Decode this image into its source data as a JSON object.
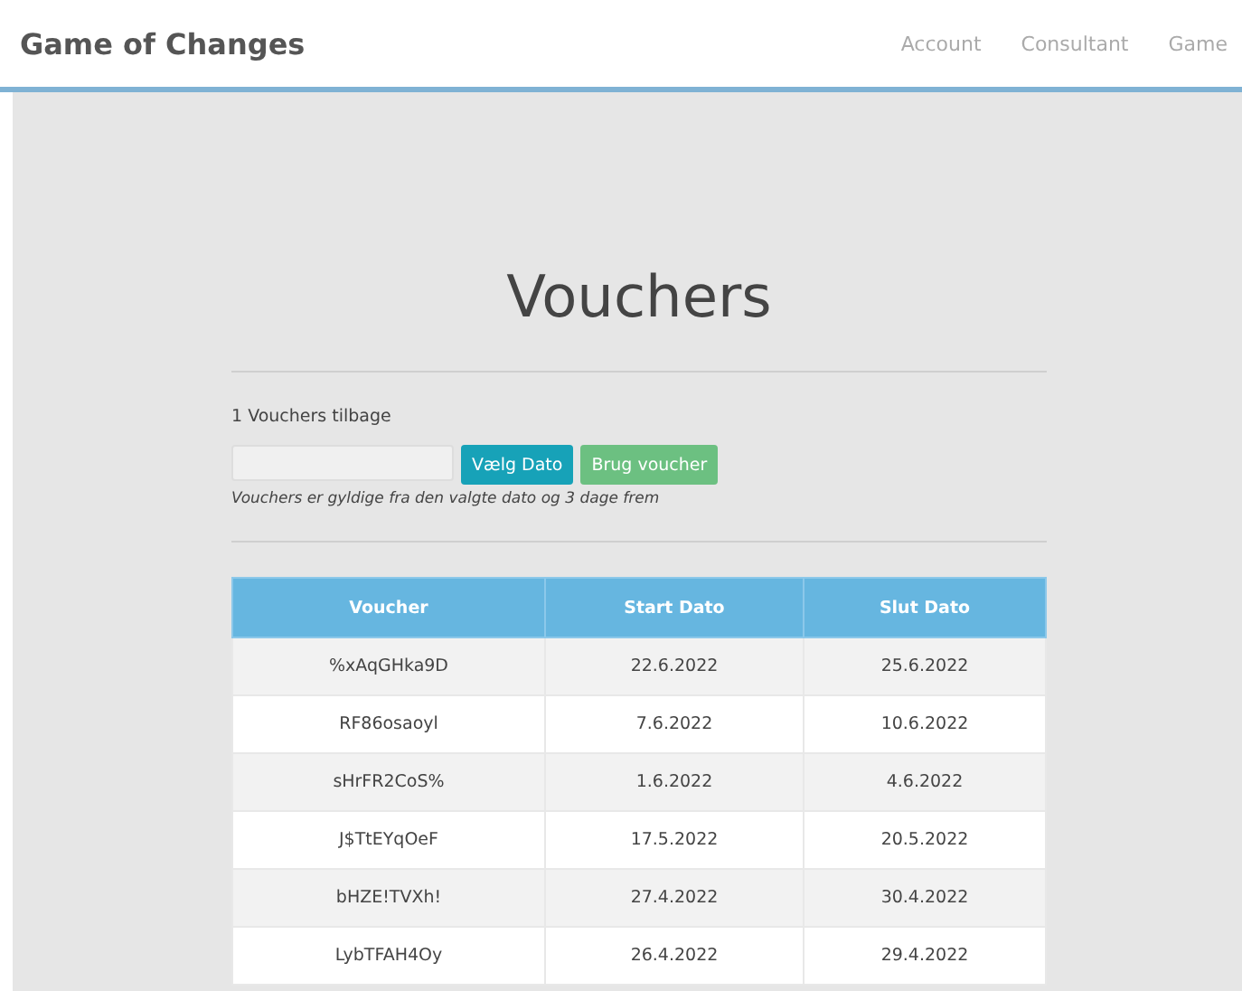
{
  "header": {
    "brand": "Game of Changes",
    "nav": [
      {
        "label": "Account"
      },
      {
        "label": "Consultant"
      },
      {
        "label": "Game"
      }
    ]
  },
  "title": "Vouchers",
  "remaining": "1 Vouchers tilbage",
  "buttons": [
    {
      "label": "Vælg Dato",
      "kind": "info"
    },
    {
      "label": "Brug voucher",
      "kind": "success"
    }
  ],
  "note": "Vouchers er gyldige fra den valgte dato og 3 dage frem",
  "table": {
    "columns": [
      "Voucher",
      "Start Dato",
      "Slut Dato"
    ],
    "rows": [
      [
        "%xAqGHka9D",
        "22.6.2022",
        "25.6.2022"
      ],
      [
        "RF86osaoyl",
        "7.6.2022",
        "10.6.2022"
      ],
      [
        "sHrFR2CoS%",
        "1.6.2022",
        "4.6.2022"
      ],
      [
        "J$TtEYqOeF",
        "17.5.2022",
        "20.5.2022"
      ],
      [
        "bHZE!TVXh!",
        "27.4.2022",
        "30.4.2022"
      ],
      [
        "LybTFAH4Oy",
        "26.4.2022",
        "29.4.2022"
      ]
    ]
  }
}
